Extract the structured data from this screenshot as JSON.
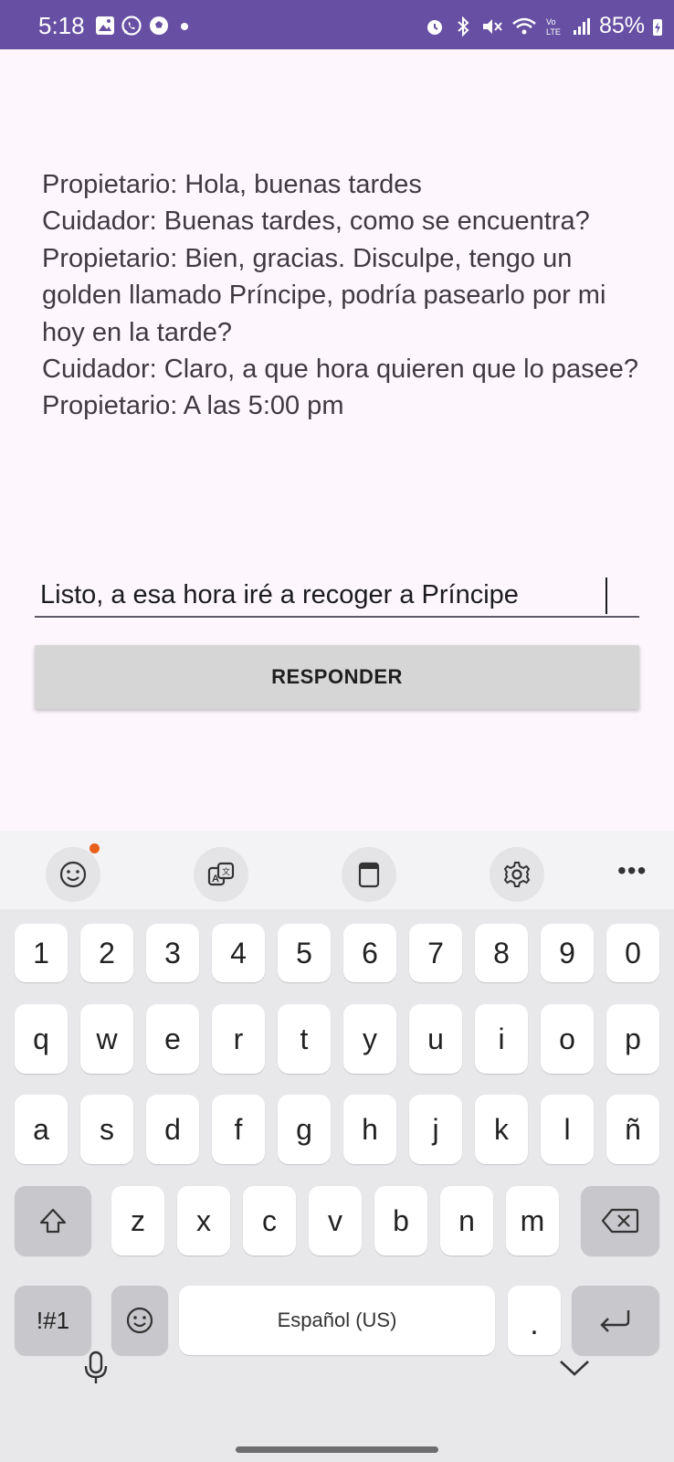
{
  "status_bar": {
    "time": "5:18",
    "battery": "85%"
  },
  "conversation_text": "Propietario: Hola, buenas tardes\nCuidador: Buenas tardes, como se encuentra?\nPropietario: Bien, gracias. Disculpe, tengo un golden llamado Príncipe, podría pasearlo por mi hoy en la tarde?\nCuidador: Claro, a que hora quieren que lo pasee?\nPropietario: A las 5:00 pm",
  "reply_input": {
    "value": "Listo, a esa hora iré a recoger a Príncipe"
  },
  "respond_button": {
    "label": "RESPONDER"
  },
  "keyboard": {
    "toolbar": [
      "emoji-icon",
      "translate-icon",
      "clipboard-icon",
      "settings-icon",
      "more-icon"
    ],
    "number_row": [
      "1",
      "2",
      "3",
      "4",
      "5",
      "6",
      "7",
      "8",
      "9",
      "0"
    ],
    "row1": [
      "q",
      "w",
      "e",
      "r",
      "t",
      "y",
      "u",
      "i",
      "o",
      "p"
    ],
    "row2": [
      "a",
      "s",
      "d",
      "f",
      "g",
      "h",
      "j",
      "k",
      "l",
      "ñ"
    ],
    "row3": [
      "z",
      "x",
      "c",
      "v",
      "b",
      "n",
      "m"
    ],
    "symbols_label": "!#1",
    "space_label": "Español (US)",
    "period_label": "."
  }
}
